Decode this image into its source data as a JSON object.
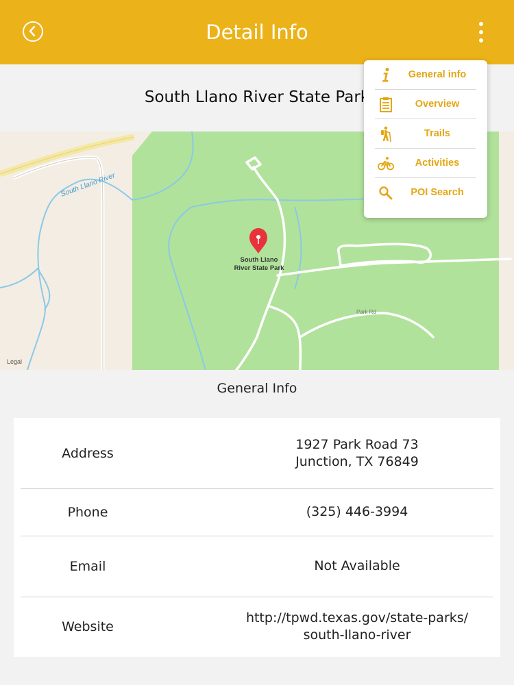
{
  "header": {
    "title": "Detail Info",
    "back_icon": "back-circle-icon",
    "more_icon": "more-vertical-icon",
    "color": "#ebb219"
  },
  "park": {
    "title": "South Llano River State Park"
  },
  "map": {
    "river_label": "South Llano River",
    "pin_label_line1": "South Llano",
    "pin_label_line2": "River State Park",
    "road_label": "Park Rd",
    "legal": "Legal",
    "pin_color": "#e8323c",
    "park_color": "#b1e29b"
  },
  "menu": {
    "accent": "#e5a613",
    "items": [
      {
        "label": "General info",
        "icon": "info-icon"
      },
      {
        "label": "Overview",
        "icon": "clipboard-icon"
      },
      {
        "label": "Trails",
        "icon": "hiker-icon"
      },
      {
        "label": "Activities",
        "icon": "bicycle-icon"
      },
      {
        "label": "POI Search",
        "icon": "search-icon"
      }
    ]
  },
  "general": {
    "section_title": "General Info",
    "rows": [
      {
        "label": "Address",
        "value_line1": "1927 Park Road 73",
        "value_line2": "Junction, TX 76849"
      },
      {
        "label": "Phone",
        "value_line1": "(325) 446-3994"
      },
      {
        "label": "Email",
        "value_line1": "Not Available"
      },
      {
        "label": "Website",
        "value_line1": "http://tpwd.texas.gov/state-parks/",
        "value_line2": "south-llano-river"
      }
    ]
  }
}
